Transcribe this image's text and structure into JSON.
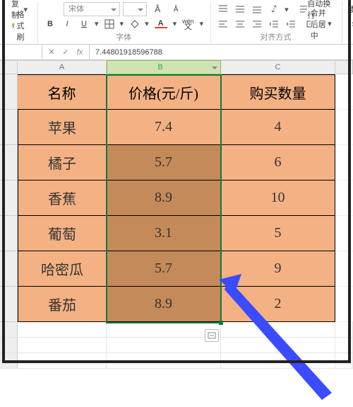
{
  "ribbon": {
    "clipboard": {
      "copy": "复制",
      "format_painter": "格式刷"
    },
    "font": {
      "family_placeholder": "宋体",
      "bold": "B",
      "italic": "I",
      "underline": "U",
      "group_label": "字体"
    },
    "align": {
      "wrap": "自动换行",
      "merge": "合并后居中",
      "group_label": "对齐方式"
    },
    "number": {
      "group_label_partial": "数"
    }
  },
  "formula_bar": {
    "name_box": "",
    "cancel": "✕",
    "confirm": "✓",
    "fx": "fx",
    "value": "7.44801918596788"
  },
  "columns": {
    "A": "A",
    "B": "B",
    "C": "C"
  },
  "table": {
    "headers": {
      "name": "名称",
      "price": "价格(元/斤)",
      "qty": "购买数量"
    },
    "rows": [
      {
        "name": "苹果",
        "price": "7.4",
        "qty": "4"
      },
      {
        "name": "橘子",
        "price": "5.7",
        "qty": "6"
      },
      {
        "name": "香蕉",
        "price": "8.9",
        "qty": "10"
      },
      {
        "name": "葡萄",
        "price": "3.1",
        "qty": "5"
      },
      {
        "name": "哈密瓜",
        "price": "5.7",
        "qty": "9"
      },
      {
        "name": "番茄",
        "price": "8.9",
        "qty": "2"
      }
    ]
  },
  "chart_data": {
    "type": "table",
    "title": "",
    "columns": [
      "名称",
      "价格(元/斤)",
      "购买数量"
    ],
    "rows": [
      [
        "苹果",
        7.4,
        4
      ],
      [
        "橘子",
        5.7,
        6
      ],
      [
        "香蕉",
        8.9,
        10
      ],
      [
        "葡萄",
        3.1,
        5
      ],
      [
        "哈密瓜",
        5.7,
        9
      ],
      [
        "番茄",
        8.9,
        2
      ]
    ]
  }
}
